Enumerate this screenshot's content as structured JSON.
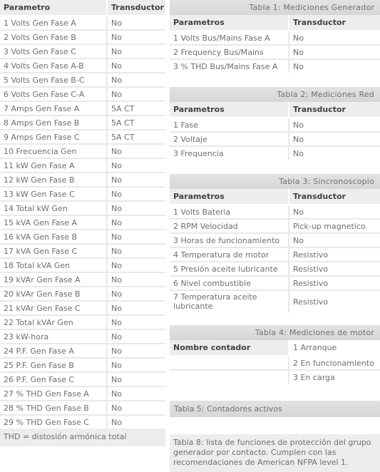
{
  "left_table": {
    "headers": [
      "Parametro",
      "Transductor"
    ],
    "rows": [
      [
        "1 Volts Gen Fase A",
        "No"
      ],
      [
        "2 Volts Gen Fase B",
        "No"
      ],
      [
        "3 Volts Gen Fase C",
        "No"
      ],
      [
        "4 Volts Gen Fase A-B",
        "No"
      ],
      [
        "5 Volts Gen Fase B-C",
        "No"
      ],
      [
        "6 Volts Gen Fase C-A",
        "No"
      ],
      [
        "7 Amps Gen Fase A",
        "5A CT"
      ],
      [
        "8 Amps Gen Fase B",
        "5A CT"
      ],
      [
        "9 Amps Gen Fase C",
        "5A CT"
      ],
      [
        "10 Frecuencia Gen",
        "No"
      ],
      [
        "11 kW Gen Fase A",
        "No"
      ],
      [
        "12 kW Gen Fase B",
        "No"
      ],
      [
        "13 kW Gen Fase C",
        "No"
      ],
      [
        "14 Total kW Gen",
        "No"
      ],
      [
        "15 kVA Gen Fase A",
        "No"
      ],
      [
        "16 kVA Gen Fase B",
        "No"
      ],
      [
        "17 kVA Gen Fase C",
        "No"
      ],
      [
        "18 Total kVA Gen",
        "No"
      ],
      [
        "19 kVAr Gen Fase A",
        "No"
      ],
      [
        "20 kVAr Gen Fase B",
        "No"
      ],
      [
        "21 kVAr Gen Fase C",
        "No"
      ],
      [
        "22 Total kVAr Gen",
        "No"
      ],
      [
        "23 kW-hora",
        "No"
      ],
      [
        "24 P.F. Gen Fase A",
        "No"
      ],
      [
        "25 P.F. Gen Fase B",
        "No"
      ],
      [
        "26 P.F. Gen Fase C",
        "No"
      ],
      [
        "27 % THD Gen Fase A",
        "No"
      ],
      [
        "28 % THD Gen Fase B",
        "No"
      ],
      [
        "29 % THD Gen Fase C",
        "No"
      ]
    ],
    "footnote": "THD = distosión armónica total"
  },
  "tabla1": {
    "caption": "Tabla 1:  Mediciones Generador",
    "headers": [
      "Parametros",
      "Transductor"
    ],
    "rows": [
      [
        "1 Volts Bus/Mains Fase A",
        "No"
      ],
      [
        "2 Frequency Bus/Mains",
        "No"
      ],
      [
        "3 % THD Bus/Mains Fase A",
        "No"
      ]
    ]
  },
  "tabla2": {
    "caption": "Tabla 2:  Mediciones Red",
    "headers": [
      "Parametros",
      "Transductor"
    ],
    "rows": [
      [
        "1 Fase",
        "No"
      ],
      [
        "2 Voltaje",
        "No"
      ],
      [
        "3 Frequencia",
        "No"
      ]
    ]
  },
  "tabla3": {
    "caption": "Tabla 3:  Sincronoscopio",
    "headers": [
      "Parametros",
      "Transductor"
    ],
    "rows": [
      [
        "1 Volts Bateria",
        "No"
      ],
      [
        "2 RPM Velocidad",
        "Pick-up magnetico"
      ],
      [
        "3 Horas de funcionamiento",
        "No"
      ],
      [
        "4 Temperatura de motor",
        "Resistivo"
      ],
      [
        "5 Presión aceite lubricante",
        "Resistivo"
      ],
      [
        "6 Nivel combustible",
        "Resistivo"
      ],
      [
        "7 Temperatura aceite lubricante",
        "Resistivo"
      ]
    ]
  },
  "tabla4": {
    "caption": "Tabla 4:  Mediciones de motor",
    "header_left": "Nombre contador",
    "rows": [
      [
        "",
        "1 Arranque"
      ],
      [
        "",
        "2 En funcionamiento"
      ],
      [
        "",
        "3 En carga"
      ]
    ]
  },
  "tabla5": {
    "caption": "Tabla 5: Contadores activos"
  },
  "tabla8": {
    "note": "Tabla 8: lista de funciones de protección del grupo generador por contacto. Cumplen con las recomendaciones de American NFPA level 1."
  }
}
